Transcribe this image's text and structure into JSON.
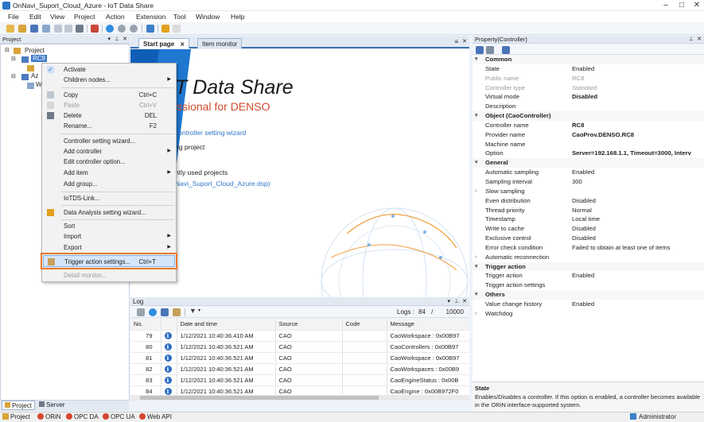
{
  "window": {
    "title": "OnNavi_Suport_Cloud_Azure - IoT Data Share"
  },
  "menu": [
    "File",
    "Edit",
    "View",
    "Project",
    "Action",
    "Extension",
    "Tool",
    "Window",
    "Help"
  ],
  "project_panel": {
    "title": "Project",
    "root": "Project",
    "selected_node": "RC8",
    "node2": "Az",
    "node3": "W"
  },
  "tabs": {
    "start": "Start page",
    "monitor": "Item monitor"
  },
  "start_page": {
    "brand_title": "T Data Share",
    "brand_subtitle": "ssional for DENSO",
    "wizard_link": "controller setting wizard",
    "line2": "ng project",
    "recent_heading": "ntly used projects",
    "recent_file": "Navi_Suport_Cloud_Azure.dsp)"
  },
  "context_menu": {
    "activate": "Activate",
    "children": "Children nodes...",
    "copy": "Copy",
    "copy_sc": "Ctrl+C",
    "paste": "Paste",
    "paste_sc": "Ctrl+V",
    "delete": "Delete",
    "delete_sc": "DEL",
    "rename": "Rename...",
    "rename_sc": "F2",
    "ctrl_wizard": "Controller setting wizard...",
    "add_controller": "Add controller",
    "edit_controller": "Edit controller option...",
    "add_item": "Add item",
    "add_group": "Add group...",
    "iotds_link": "IoTDS-Link...",
    "data_analysis": "Data Analysis setting wizard...",
    "sort": "Sort",
    "import": "Import",
    "export": "Export",
    "trigger": "Trigger action settings...",
    "trigger_sc": "Ctrl+T",
    "detail": "Detail monitor..."
  },
  "log": {
    "title": "Log",
    "logs_label": "Logs :",
    "logs_count": "84",
    "logs_sep": "/",
    "logs_max": "10000",
    "columns": [
      "No.",
      "",
      "Date and time",
      "Source",
      "Code",
      "Message"
    ],
    "rows": [
      {
        "no": "79",
        "date": "1/12/2021 10:40:36.410 AM",
        "source": "CAO",
        "code": "",
        "message": "CaoWorkspace : 0x00B97"
      },
      {
        "no": "80",
        "date": "1/12/2021 10:40:36.521 AM",
        "source": "CAO",
        "code": "",
        "message": "CaoControllers : 0x00B97"
      },
      {
        "no": "81",
        "date": "1/12/2021 10:40:36.521 AM",
        "source": "CAO",
        "code": "",
        "message": "CaoWorkspace : 0x00B97"
      },
      {
        "no": "82",
        "date": "1/12/2021 10:40:36.521 AM",
        "source": "CAO",
        "code": "",
        "message": "CaoWorkspaces : 0x00B9"
      },
      {
        "no": "83",
        "date": "1/12/2021 10:40:36.521 AM",
        "source": "CAO",
        "code": "",
        "message": "CaoEngineStatus : 0x00B"
      },
      {
        "no": "84",
        "date": "1/12/2021 10:40:36.521 AM",
        "source": "CAO",
        "code": "",
        "message": "CaoEngine : 0x00B972F0"
      }
    ]
  },
  "properties": {
    "title": "Property(Controller)",
    "rows": [
      {
        "type": "cat",
        "k": "Common"
      },
      {
        "k": "State",
        "v": "Enabled"
      },
      {
        "k": "Public name",
        "v": "RC8",
        "dis": true
      },
      {
        "k": "Controller type",
        "v": "Standard",
        "dis": true
      },
      {
        "k": "Virtual mode",
        "v": "Disabled",
        "bold": true
      },
      {
        "k": "Description",
        "v": ""
      },
      {
        "type": "cat",
        "k": "Object (CaoController)"
      },
      {
        "k": "Controller name",
        "v": "RC8",
        "bold": true
      },
      {
        "k": "Provider name",
        "v": "CaoProv.DENSO.RC8",
        "bold": true
      },
      {
        "k": "Machine name",
        "v": ""
      },
      {
        "k": "Option",
        "v": "Server=192.168.1.1, Timeout=3000, Interv",
        "bold": true
      },
      {
        "type": "cat",
        "k": "General"
      },
      {
        "k": "Automatic sampling",
        "v": "Enabled"
      },
      {
        "k": "Sampling interval",
        "v": "300"
      },
      {
        "k": "Slow sampling",
        "v": "",
        "exp": true
      },
      {
        "k": "Even distribution",
        "v": "Disabled"
      },
      {
        "k": "Thread priority",
        "v": "Normal"
      },
      {
        "k": "Timestamp",
        "v": "Local time"
      },
      {
        "k": "Write to cache",
        "v": "Disabled"
      },
      {
        "k": "Exclusive control",
        "v": "Disabled"
      },
      {
        "k": "Error check condition",
        "v": "Failed to obtain at least one of items"
      },
      {
        "k": "Automatic reconnection",
        "v": "",
        "exp": true
      },
      {
        "type": "cat",
        "k": "Trigger action"
      },
      {
        "k": "Trigger action",
        "v": "Enabled"
      },
      {
        "k": "Trigger action settings",
        "v": ""
      },
      {
        "type": "cat",
        "k": "Others"
      },
      {
        "k": "Value change history",
        "v": "Enabled"
      },
      {
        "k": "Watchdog",
        "v": "",
        "exp": true
      }
    ],
    "desc_title": "State",
    "desc_text": "Enables/Disables a controller. If this option is enabled, a controller becomes available in the ORiN interface-supported system."
  },
  "bottom_tabs": {
    "project": "Project",
    "server": "Server"
  },
  "status": {
    "project": "Project",
    "orin": "ORiN",
    "opcda": "OPC DA",
    "opcua": "OPC UA",
    "webapi": "Web API",
    "user": "Administrator"
  }
}
